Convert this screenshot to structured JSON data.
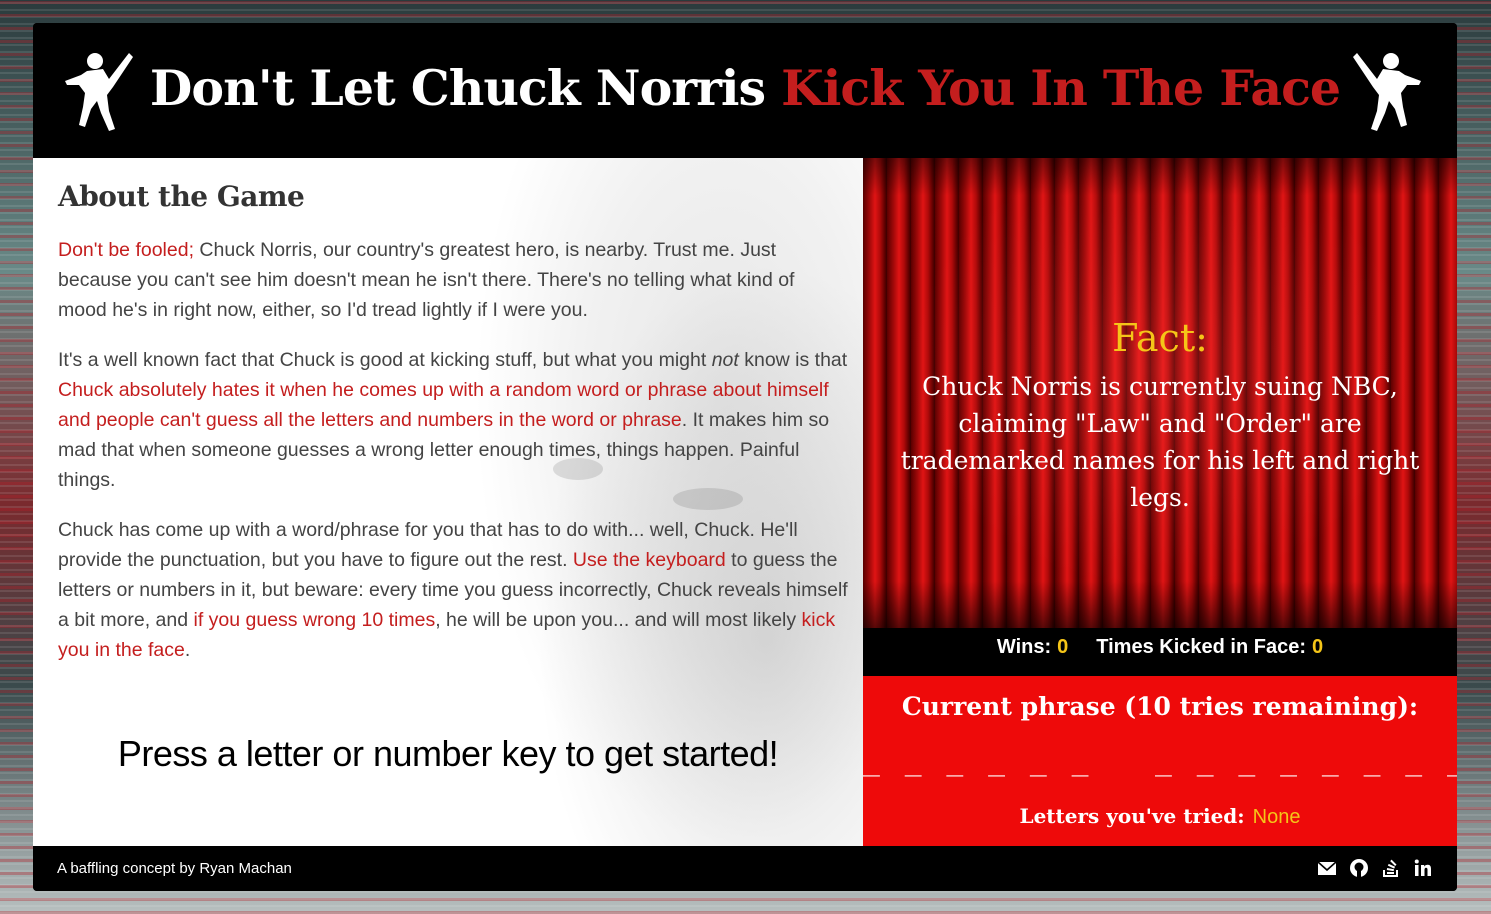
{
  "header": {
    "title_white": "Don't Let Chuck Norris ",
    "title_red": "Kick You In The Face"
  },
  "about": {
    "title": "About the Game",
    "p1": {
      "hl1": "Don't be fooled;",
      "t1": " Chuck Norris, our country's greatest hero, is nearby. Trust me. Just because you can't see him doesn't mean he isn't there. There's no telling what kind of mood he's in right now, either, so I'd tread lightly if I were you."
    },
    "p2": {
      "t1": "It's a well known fact that Chuck is good at kicking stuff, but what you might ",
      "em": "not",
      "t2": " know is that ",
      "hl1": "Chuck absolutely hates it when he comes up with a random word or phrase about himself and people can't guess all the letters and numbers in the word or phrase",
      "t3": ". It makes him so mad that when someone guesses a wrong letter enough times, things happen. Painful things."
    },
    "p3": {
      "t1": "Chuck has come up with a word/phrase for you that has to do with... well, Chuck. He'll provide the punctuation, but you have to figure out the rest. ",
      "hl1": "Use the keyboard",
      "t2": " to guess the letters or numbers in it, but beware: every time you guess incorrectly, Chuck reveals himself a bit more, and ",
      "hl2": "if you guess wrong 10 times",
      "t3": ", he will be upon you... and will most likely ",
      "hl3": "kick you in the face",
      "t4": "."
    },
    "start_prompt": "Press a letter or number key to get started!"
  },
  "fact": {
    "label": "Fact:",
    "text": "Chuck Norris is currently suing NBC, claiming \"Law\" and \"Order\" are trademarked names for his left and right legs."
  },
  "stats": {
    "wins_label": "Wins:",
    "wins": "0",
    "kicked_label": "Times Kicked in Face:",
    "kicked": "0"
  },
  "phrase": {
    "title": "Current phrase (10 tries remaining):",
    "blanks": "_ _ _ _ _ _   _ _ _ _ _ _ _ _ _",
    "tried_label": "Letters you've tried:",
    "tried_value": "None"
  },
  "footer": {
    "credit": "A baffling concept by Ryan Machan",
    "icons": [
      "envelope-icon",
      "github-icon",
      "stack-overflow-icon",
      "linkedin-icon"
    ]
  },
  "colors": {
    "accent_red": "#c41e1e",
    "highlight_yellow": "#f5c518",
    "phrase_bg": "#ee0a0a"
  }
}
